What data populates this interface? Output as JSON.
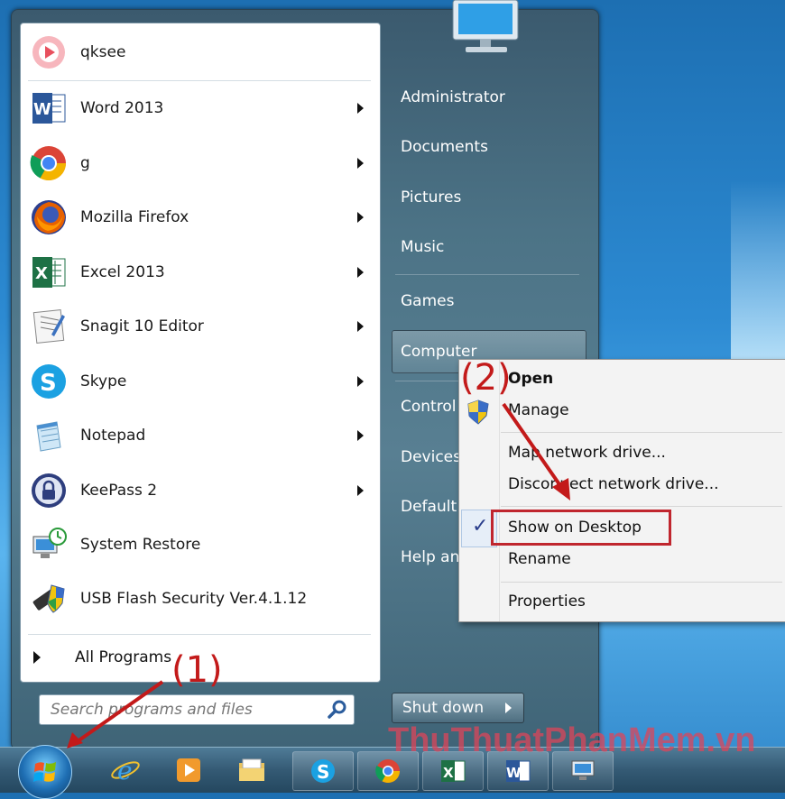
{
  "programs": [
    {
      "label": "qksee",
      "has_arrow": false,
      "icon": "qksee-icon"
    },
    {
      "label": "Word 2013",
      "has_arrow": true,
      "icon": "word-icon"
    },
    {
      "label": "g",
      "has_arrow": true,
      "icon": "chrome-icon"
    },
    {
      "label": "Mozilla Firefox",
      "has_arrow": true,
      "icon": "firefox-icon"
    },
    {
      "label": "Excel 2013",
      "has_arrow": true,
      "icon": "excel-icon"
    },
    {
      "label": "Snagit 10 Editor",
      "has_arrow": true,
      "icon": "snagit-icon"
    },
    {
      "label": "Skype",
      "has_arrow": true,
      "icon": "skype-icon"
    },
    {
      "label": "Notepad",
      "has_arrow": true,
      "icon": "notepad-icon"
    },
    {
      "label": "KeePass 2",
      "has_arrow": true,
      "icon": "keepass-icon"
    },
    {
      "label": "System Restore",
      "has_arrow": false,
      "icon": "system-restore-icon"
    },
    {
      "label": "USB Flash Security Ver.4.1.12",
      "has_arrow": false,
      "icon": "usb-flash-icon"
    }
  ],
  "all_programs": "All Programs",
  "search": {
    "placeholder": "Search programs and files"
  },
  "right_items": [
    "Administrator",
    "Documents",
    "Pictures",
    "Music",
    "Games",
    "Computer",
    "Control",
    "Devices",
    "Default",
    "Help an"
  ],
  "shutdown": "Shut down",
  "context_menu": {
    "open": "Open",
    "manage": "Manage",
    "map_drive": "Map network drive...",
    "disconnect_drive": "Disconnect network drive...",
    "show_on_desktop": "Show on Desktop",
    "rename": "Rename",
    "properties": "Properties"
  },
  "annotations": {
    "one": "(1)",
    "two": "(2)"
  },
  "watermark": "ThuThuatPhanMem.vn",
  "taskbar": [
    "ie-icon",
    "media-player-icon",
    "file-explorer-icon",
    "skype-icon",
    "chrome-icon",
    "excel-icon",
    "word-icon",
    "remote-desktop-icon"
  ],
  "colors": {
    "annotation": "#c31a1a",
    "highlight_box": "#c0262e",
    "menu_bg": "#f3f3f3"
  }
}
